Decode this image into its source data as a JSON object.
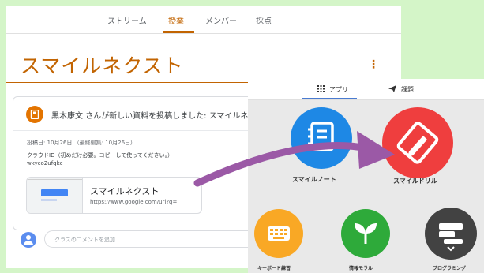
{
  "classroom": {
    "tabs": [
      "ストリーム",
      "授業",
      "メンバー",
      "採点"
    ],
    "active_tab": "授業",
    "title": "スマイルネクスト",
    "kebab": "⋮",
    "post": {
      "title": "黒木康文 さんが新しい資料を投稿しました: スマイルネクスト",
      "meta": "投稿日: 10月26日 （最終編集: 10月26日）",
      "body_line1": "クラウドID（初めだけ必要。コピーして使ってください。）",
      "body_line2": "wkyco2ufqkc",
      "attachment": {
        "title": "スマイルネクスト",
        "url": "https://www.google.com/url?q="
      }
    },
    "comment_placeholder": "クラスのコメントを追加..."
  },
  "launcher": {
    "tabs": [
      "アプリ",
      "課題"
    ],
    "apps": [
      {
        "label": "スマイルノート",
        "color": "#1e88e5"
      },
      {
        "label": "スマイルドリル",
        "color": "#ef3e3e"
      },
      {
        "label": "キーボード練習",
        "color": "#f9a825"
      },
      {
        "label": "情報モラル",
        "color": "#2eaa3a"
      },
      {
        "label": "プログラミング",
        "color": "#424242"
      }
    ]
  },
  "colors": {
    "accent": "#c26401",
    "arrow": "#9b59a6",
    "background": "#d4f5c8"
  }
}
